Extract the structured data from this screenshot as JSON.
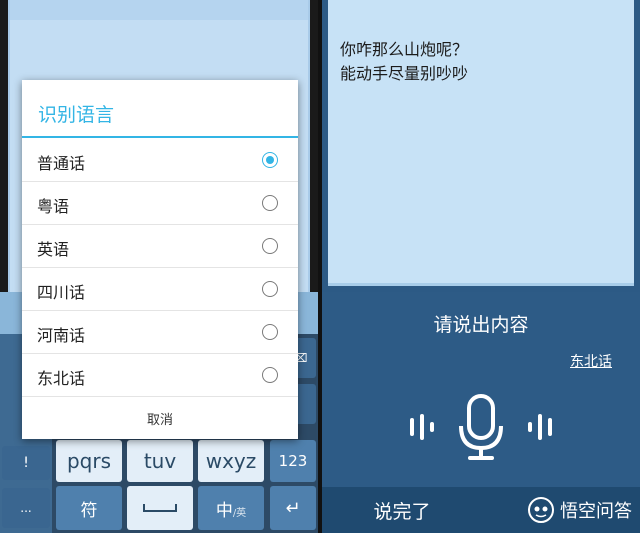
{
  "dialog": {
    "title": "识别语言",
    "options": [
      {
        "label": "普通话",
        "selected": true
      },
      {
        "label": "粤语",
        "selected": false
      },
      {
        "label": "英语",
        "selected": false
      },
      {
        "label": "四川话",
        "selected": false
      },
      {
        "label": "河南话",
        "selected": false
      },
      {
        "label": "东北话",
        "selected": false
      }
    ],
    "cancel": "取消"
  },
  "keyboard": {
    "keys": {
      "exclaim": "!",
      "ellipsis": "...",
      "pqrs": "pqrs",
      "tuv": "tuv",
      "wxyz": "wxyz",
      "num": "123",
      "symbol": "符",
      "lang_zh": "中",
      "lang_en": "/英",
      "enter": "↵"
    }
  },
  "note": {
    "line1": "你咋那么山炮呢？",
    "line2": "能动手尽量别吵吵"
  },
  "voice": {
    "prompt": "请说出内容",
    "dialect": "东北话",
    "done": "说完了"
  },
  "watermark": {
    "text": "悟空问答"
  },
  "colors": {
    "accent": "#33b5e5",
    "voice_bg": "#2d5b86",
    "note_bg": "#c7e2f6"
  }
}
